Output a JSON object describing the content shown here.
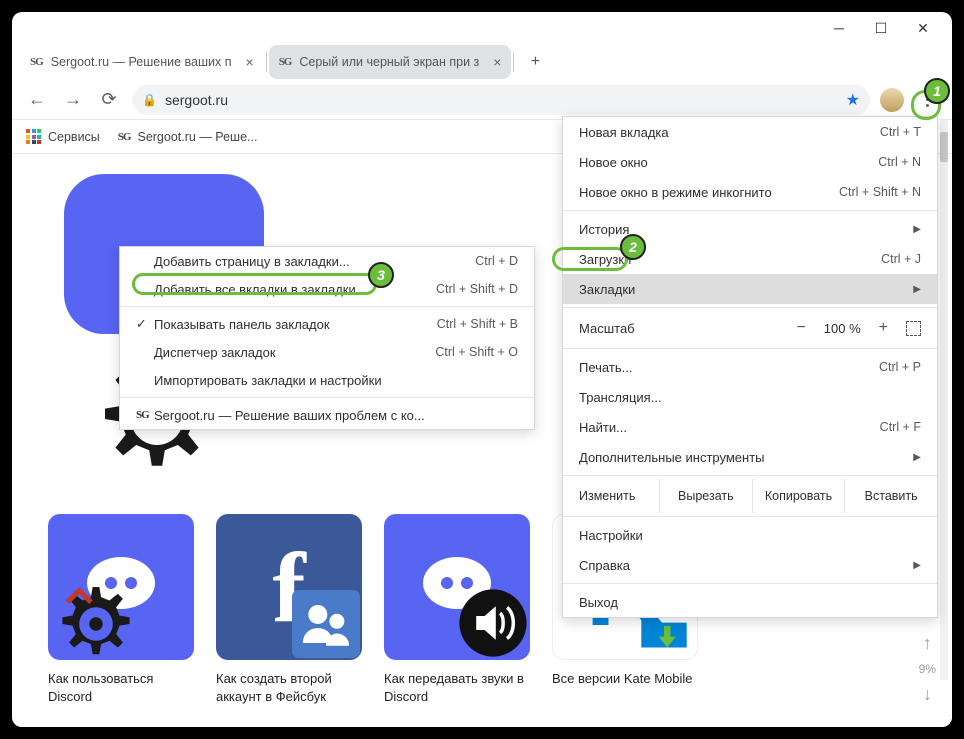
{
  "tabs": [
    {
      "title": "Sergoot.ru — Решение ваших п"
    },
    {
      "title": "Серый или черный экран при з"
    }
  ],
  "url": "sergoot.ru",
  "bookmarks_bar": {
    "services": "Сервисы",
    "item1": "Sergoot.ru — Реше..."
  },
  "menu": {
    "new_tab": {
      "label": "Новая вкладка",
      "shortcut": "Ctrl + T"
    },
    "new_window": {
      "label": "Новое окно",
      "shortcut": "Ctrl + N"
    },
    "incognito": {
      "label": "Новое окно в режиме инкогнито",
      "shortcut": "Ctrl + Shift + N"
    },
    "history": {
      "label": "История"
    },
    "downloads": {
      "label": "Загрузки",
      "shortcut": "Ctrl + J"
    },
    "bookmarks": {
      "label": "Закладки"
    },
    "zoom": {
      "label": "Масштаб",
      "value": "100 %"
    },
    "print": {
      "label": "Печать...",
      "shortcut": "Ctrl + P"
    },
    "cast": {
      "label": "Трансляция..."
    },
    "find": {
      "label": "Найти...",
      "shortcut": "Ctrl + F"
    },
    "more_tools": {
      "label": "Дополнительные инструменты"
    },
    "edit": {
      "label": "Изменить",
      "cut": "Вырезать",
      "copy": "Копировать",
      "paste": "Вставить"
    },
    "settings": {
      "label": "Настройки"
    },
    "help": {
      "label": "Справка"
    },
    "exit": {
      "label": "Выход"
    }
  },
  "submenu": {
    "add_page": {
      "label": "Добавить страницу в закладки...",
      "shortcut": "Ctrl + D"
    },
    "add_all": {
      "label": "Добавить все вкладки в закладки...",
      "shortcut": "Ctrl + Shift + D"
    },
    "show_bar": {
      "label": "Показывать панель закладок",
      "shortcut": "Ctrl + Shift + B"
    },
    "manager": {
      "label": "Диспетчер закладок",
      "shortcut": "Ctrl + Shift + O"
    },
    "import": {
      "label": "Импортировать закладки и настройки"
    },
    "recent": {
      "label": "Sergoot.ru — Решение ваших проблем с ко..."
    }
  },
  "tiles": [
    {
      "label": "Как пользоваться Discord"
    },
    {
      "label": "Как создать второй аккаунт в Фейсбук"
    },
    {
      "label": "Как передавать звуки в Discord"
    },
    {
      "label": "Все версии Kate Mobile"
    }
  ],
  "scroll_pct": "9%",
  "callouts": {
    "one": "1",
    "two": "2",
    "three": "3"
  }
}
